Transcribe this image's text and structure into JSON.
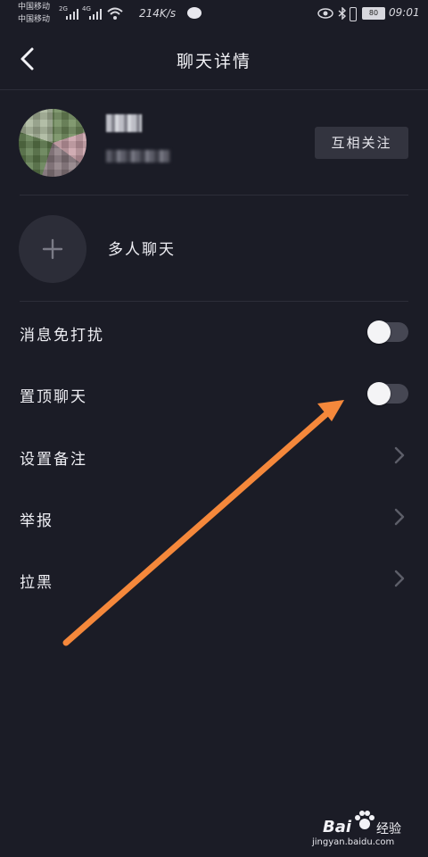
{
  "status_bar": {
    "carrier_1": "中国移动",
    "carrier_2": "中国移动",
    "net_1": "2G",
    "net_2": "4G",
    "speed": "214K/s",
    "battery": "80",
    "time": "09:01",
    "icons": [
      "signal-icon",
      "signal-icon",
      "wifi-icon",
      "message-icon",
      "eye-icon",
      "bluetooth-icon",
      "vibrate-icon",
      "battery-icon"
    ]
  },
  "header": {
    "back_icon": "chevron-left-icon",
    "title": "聊天详情"
  },
  "profile": {
    "follow_button": "互相关注"
  },
  "group_chat": {
    "icon": "plus-icon",
    "label": "多人聊天"
  },
  "settings": [
    {
      "label": "消息免打扰",
      "control": "toggle",
      "on": false
    },
    {
      "label": "置顶聊天",
      "control": "toggle",
      "on": false
    },
    {
      "label": "设置备注",
      "control": "chevron-right-icon"
    },
    {
      "label": "举报",
      "control": "chevron-right-icon"
    },
    {
      "label": "拉黑",
      "control": "chevron-right-icon"
    }
  ],
  "annotation": {
    "arrow_color": "#f5883b",
    "arrow_icon": "arrow-icon"
  },
  "watermark": {
    "brand": "Bai",
    "brand_cn": "经验",
    "url": "jingyan.baidu.com"
  },
  "colors": {
    "background": "#1b1c26",
    "accent_arrow": "#f5883b"
  }
}
